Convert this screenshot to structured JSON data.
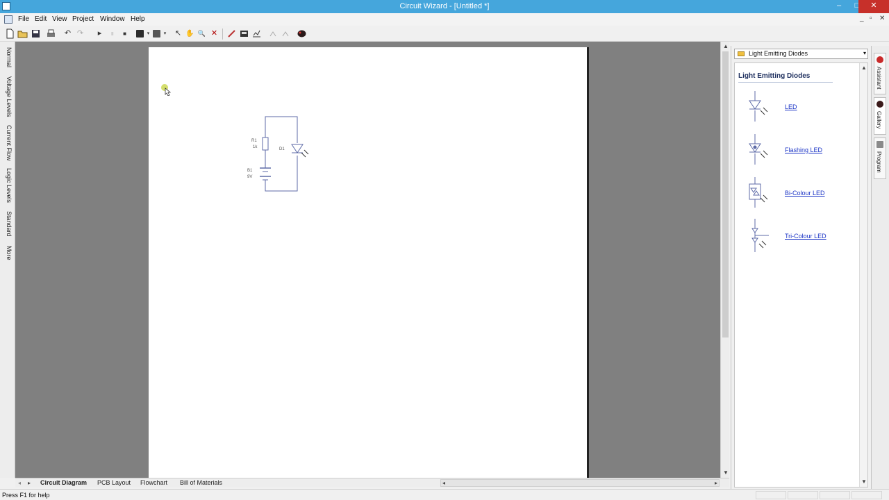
{
  "window": {
    "title": "Circuit Wizard - [Untitled *]",
    "minimize": "–",
    "maximize": "□",
    "close": "✕"
  },
  "menubar": {
    "items": [
      "File",
      "Edit",
      "View",
      "Project",
      "Window",
      "Help"
    ],
    "mdi_controls": [
      "_",
      "▫",
      "✕"
    ]
  },
  "toolbar": {
    "undo": "↶",
    "redo": "↷",
    "play": "▸",
    "pause": "॥",
    "stop": "■",
    "pointer": "↖",
    "hand": "✋",
    "zoom": "🔍",
    "delete": "✕"
  },
  "left_tabs": [
    "Normal",
    "Voltage Levels",
    "Current Flow",
    "Logic Levels",
    "Standard",
    "More"
  ],
  "circuit": {
    "r1_label": "R1",
    "r1_value": "1k",
    "b1_label": "B1",
    "b1_value": "9V",
    "d1_label": "D1"
  },
  "bottom_tabs": [
    "Circuit Diagram",
    "PCB Layout",
    "Flowchart",
    "Bill of Materials"
  ],
  "status": {
    "text": "Press F1 for help"
  },
  "gallery": {
    "selected": "Light Emitting Diodes",
    "heading": "Light Emitting Diodes",
    "items": [
      "LED",
      "Flashing LED",
      "Bi-Colour LED",
      "Tri-Colour LED"
    ]
  },
  "right_tabs": [
    "Assistant",
    "Gallery",
    "Program"
  ]
}
